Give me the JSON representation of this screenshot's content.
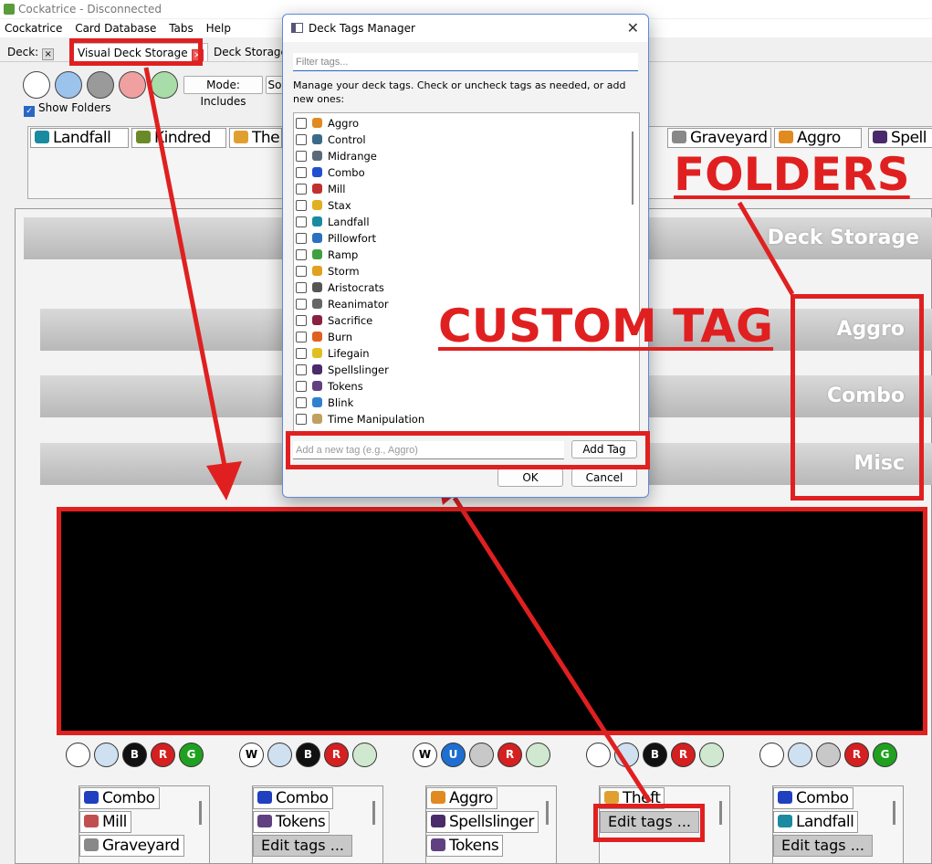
{
  "window": {
    "title": "Cockatrice - Disconnected"
  },
  "menu": [
    "Cockatrice",
    "Card Database",
    "Tabs",
    "Help"
  ],
  "tabs": {
    "deck": "Deck:",
    "visual": "Visual Deck Storage",
    "storage": "Deck Storage"
  },
  "toolbar": {
    "mode_label": "Mode: Includes",
    "sort_label": "So",
    "show_folders": "Show Folders",
    "color_filters": [
      "#ffffff",
      "#9cc3ec",
      "#9a9a9a",
      "#f0a0a0",
      "#a8dca8"
    ]
  },
  "tag_strip": [
    {
      "label": "Landfall",
      "icon": "book-icon",
      "color": "#1a8aa0"
    },
    {
      "label": "Kindred",
      "icon": "dragon-icon",
      "color": "#6a8a2a"
    },
    {
      "label": "The",
      "icon": "hand-icon",
      "color": "#e0a030"
    },
    {
      "label": "Graveyard",
      "icon": "tombstone-icon",
      "color": "#888888"
    },
    {
      "label": "Aggro",
      "icon": "runner-icon",
      "color": "#e08a20"
    },
    {
      "label": "Spell",
      "icon": "orb-icon",
      "color": "#4a2a6a"
    }
  ],
  "storage": {
    "header": "Deck Storage",
    "folders": [
      "Aggro",
      "Combo",
      "Misc"
    ]
  },
  "deck_panels": [
    {
      "colors": [
        "#ffffff",
        "#cfe0f0",
        "#111111",
        "#d42020",
        "#20a020"
      ],
      "letters": [
        "",
        "",
        "B",
        "R",
        "G"
      ],
      "tags": [
        "Combo",
        "Mill",
        "Graveyard"
      ],
      "icons": [
        "#2040c0",
        "#c05050",
        "#888888"
      ],
      "edit": ""
    },
    {
      "colors": [
        "#ffffff",
        "#cfe0f0",
        "#111111",
        "#d42020",
        "#cfe8cf"
      ],
      "letters": [
        "W",
        "",
        "B",
        "R",
        ""
      ],
      "tags": [
        "Combo",
        "Tokens"
      ],
      "icons": [
        "#2040c0",
        "#604080"
      ],
      "edit": "Edit tags ..."
    },
    {
      "colors": [
        "#ffffff",
        "#1e6fd0",
        "#c8c8c8",
        "#d42020",
        "#cfe8cf"
      ],
      "letters": [
        "W",
        "U",
        "",
        "R",
        ""
      ],
      "tags": [
        "Aggro",
        "Spellslinger",
        "Tokens"
      ],
      "icons": [
        "#e08a20",
        "#4a2a6a",
        "#604080"
      ],
      "edit": ""
    },
    {
      "colors": [
        "#ffffff",
        "#cfe0f0",
        "#111111",
        "#d42020",
        "#cfe8cf"
      ],
      "letters": [
        "",
        "",
        "B",
        "R",
        ""
      ],
      "tags": [
        "Theft"
      ],
      "icons": [
        "#e0a030"
      ],
      "edit": "Edit tags ..."
    },
    {
      "colors": [
        "#ffffff",
        "#cfe0f0",
        "#c8c8c8",
        "#d42020",
        "#20a020"
      ],
      "letters": [
        "",
        "",
        "",
        "R",
        "G"
      ],
      "tags": [
        "Combo",
        "Landfall"
      ],
      "icons": [
        "#2040c0",
        "#1a8aa0"
      ],
      "edit": "Edit tags ..."
    }
  ],
  "dialog": {
    "title": "Deck Tags Manager",
    "filter_placeholder": "Filter tags...",
    "instructions": "Manage your deck tags. Check or uncheck tags as needed, or add new ones:",
    "tags": [
      {
        "label": "Aggro",
        "color": "#e08a20"
      },
      {
        "label": "Control",
        "color": "#3a6a8a"
      },
      {
        "label": "Midrange",
        "color": "#5a6a7a"
      },
      {
        "label": "Combo",
        "color": "#2050d0"
      },
      {
        "label": "Mill",
        "color": "#c03030"
      },
      {
        "label": "Stax",
        "color": "#e0b020"
      },
      {
        "label": "Landfall",
        "color": "#1a8aa0"
      },
      {
        "label": "Pillowfort",
        "color": "#2a70c0"
      },
      {
        "label": "Ramp",
        "color": "#40a040"
      },
      {
        "label": "Storm",
        "color": "#e0a020"
      },
      {
        "label": "Aristocrats",
        "color": "#555555"
      },
      {
        "label": "Reanimator",
        "color": "#666666"
      },
      {
        "label": "Sacrifice",
        "color": "#8a2040"
      },
      {
        "label": "Burn",
        "color": "#e06020"
      },
      {
        "label": "Lifegain",
        "color": "#e0c020"
      },
      {
        "label": "Spellslinger",
        "color": "#4a2a6a"
      },
      {
        "label": "Tokens",
        "color": "#604080"
      },
      {
        "label": "Blink",
        "color": "#3080d0"
      },
      {
        "label": "Time Manipulation",
        "color": "#c0a060"
      }
    ],
    "new_tag_placeholder": "Add a new tag (e.g., Aggro)",
    "add_button": "Add Tag",
    "ok_button": "OK",
    "cancel_button": "Cancel"
  },
  "annotations": {
    "folders": "FOLDERS",
    "custom_tag": "CUSTOM TAG",
    "accent": "#e02020"
  }
}
